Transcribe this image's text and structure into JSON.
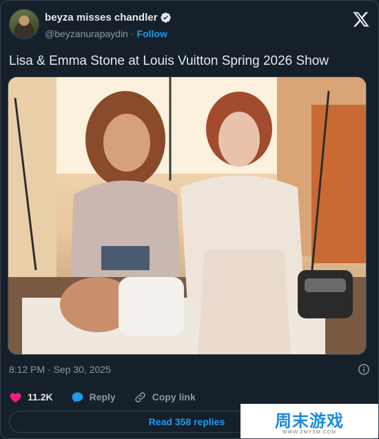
{
  "author": {
    "display_name": "beyza misses chandler",
    "handle": "@beyzanurapaydin",
    "separator": "·",
    "follow_label": "Follow"
  },
  "tweet": {
    "text": "Lisa & Emma Stone at Louis Vuitton Spring 2026 Show",
    "timestamp": "8:12 PM · Sep 30, 2025"
  },
  "actions": {
    "likes": "11.2K",
    "reply_label": "Reply",
    "copy_link_label": "Copy link"
  },
  "read_replies_label": "Read 358 replies",
  "watermark": {
    "main": "周末游戏",
    "sub": "WWW.ZMYSM.COM"
  },
  "colors": {
    "background": "#15202b",
    "accent": "#1d9bf0",
    "like": "#f91880",
    "muted": "#8b98a5"
  },
  "icons": [
    "verified-icon",
    "x-logo-icon",
    "info-icon",
    "heart-icon",
    "reply-bubble-icon",
    "link-icon"
  ]
}
